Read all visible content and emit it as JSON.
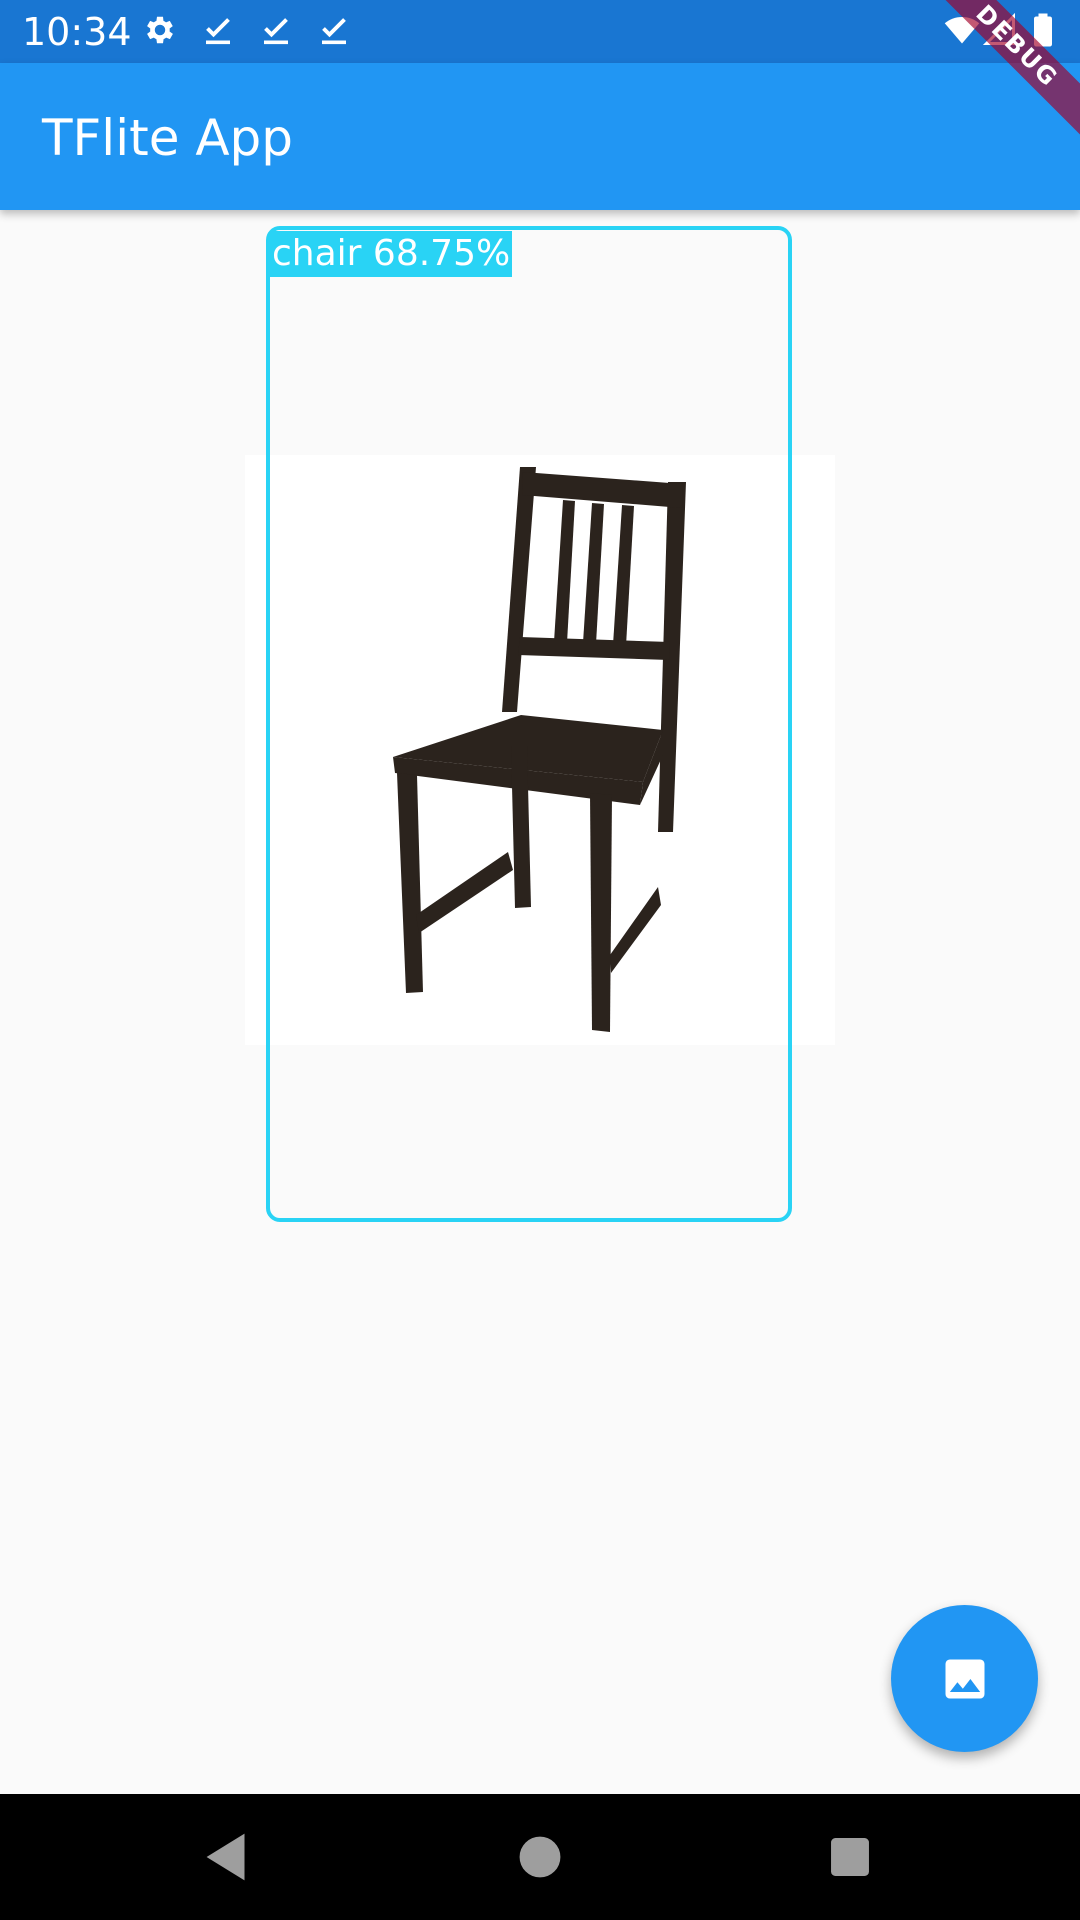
{
  "status_bar": {
    "time": "10:34",
    "icons_left": [
      "gear-icon",
      "download-done-icon",
      "download-done-icon",
      "download-done-icon"
    ],
    "icons_right": [
      "wifi-icon",
      "signal-icon",
      "battery-icon"
    ],
    "color": "#1976d2"
  },
  "app_bar": {
    "title": "TFlite App",
    "color": "#2196f3"
  },
  "debug_banner": {
    "label": "DEBUG"
  },
  "detection": {
    "label": "chair 68.75%",
    "color": "#29d3f5"
  },
  "fab": {
    "icon": "image-icon"
  },
  "nav_bar": {
    "buttons": [
      "back-icon",
      "home-icon",
      "recents-icon"
    ]
  }
}
